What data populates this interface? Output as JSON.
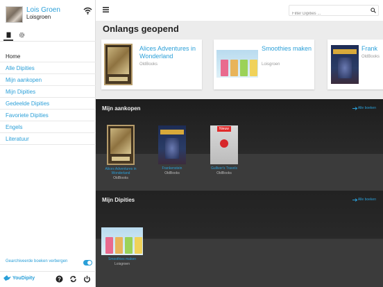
{
  "sidebar": {
    "profile_name": "Lois Groen",
    "profile_user": "Loisgroen",
    "nav": [
      "Home",
      "Alle Dipities",
      "Mijn aankopen",
      "Mijn Dipities",
      "Gedeelde Dipities",
      "Favoriete Dipities",
      "Engels",
      "Literatuur"
    ],
    "archive_label": "Gearchiveerde boeken verbergen",
    "archive_toggle_on": true,
    "logo": "YouDipity"
  },
  "topbar": {
    "search_placeholder": "Filter Dipities ..."
  },
  "recent": {
    "title": "Onlangs geopend",
    "items": [
      {
        "title": "Alices Adventures in Wonderland",
        "subtitle": "OldBooks"
      },
      {
        "title": "Smoothies maken",
        "subtitle": "Loisgroen"
      },
      {
        "title": "Frank",
        "subtitle": "OldBooks"
      }
    ]
  },
  "purchases": {
    "title": "Mijn aankopen",
    "all_link": "Alle boeken",
    "books": [
      {
        "title": "Alices Adventures in Wonderland",
        "publisher": "OldBooks"
      },
      {
        "title": "Frankenstein",
        "publisher": "OldBooks"
      },
      {
        "title": "Gulliver's Travels",
        "publisher": "OldBooks",
        "badge": "Nieuw"
      }
    ]
  },
  "dipities": {
    "title": "Mijn Dipities",
    "all_link": "Alle boeken",
    "books": [
      {
        "title": "Smoothies maken",
        "publisher": "Loisgroen"
      }
    ]
  },
  "colors": {
    "accent": "#2a9fd8",
    "badge": "#e02a2a",
    "dark_section": "#262626"
  }
}
